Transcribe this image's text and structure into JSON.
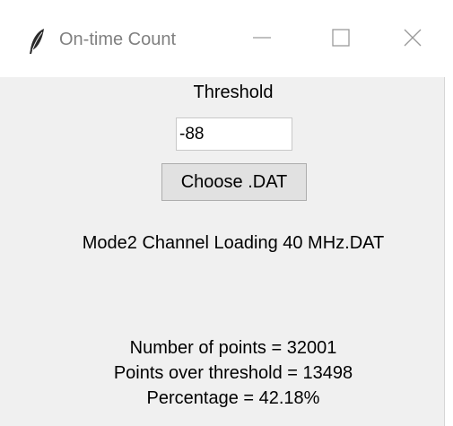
{
  "window": {
    "title": "On-time Count",
    "icon": "feather-icon",
    "controls": [
      "minimize-icon",
      "maximize-icon",
      "close-icon"
    ]
  },
  "form": {
    "threshold_label": "Threshold",
    "threshold_value": "-88",
    "choose_button_label": "Choose .DAT",
    "file_name": "Mode2 Channel Loading 40 MHz.DAT"
  },
  "results": {
    "points_line": "Number of points = 32001",
    "over_threshold_line": "Points over threshold = 13498",
    "percentage_line": "Percentage = 42.18%"
  }
}
